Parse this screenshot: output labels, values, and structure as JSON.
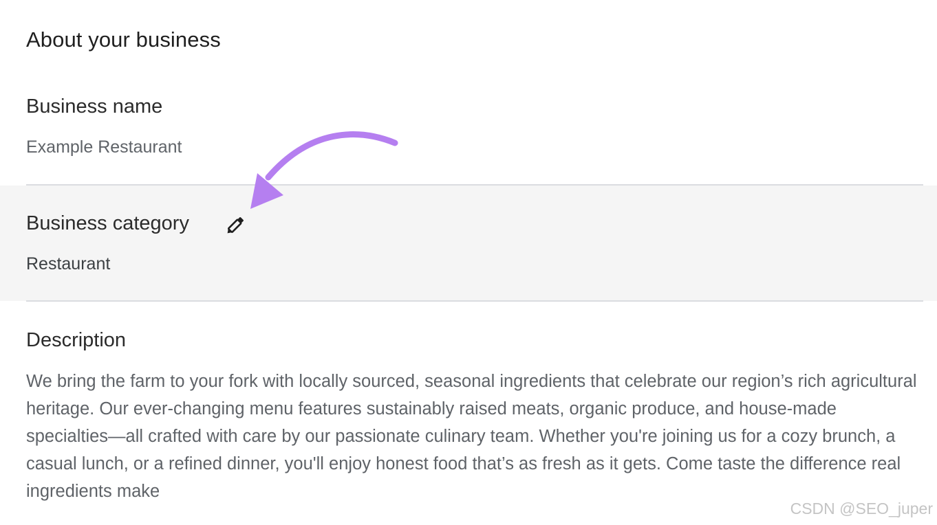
{
  "section": {
    "title": "About your business"
  },
  "business_name": {
    "label": "Business name",
    "value": "Example Restaurant"
  },
  "business_category": {
    "label": "Business category",
    "value": "Restaurant",
    "edit_icon": "pencil-icon"
  },
  "description": {
    "label": "Description",
    "text": "We bring the farm to your fork with locally sourced, seasonal ingredients that celebrate our region’s rich agricultural heritage. Our ever-changing menu features sustainably raised meats, organic produce, and house-made specialties—all crafted with care by our passionate culinary team. Whether you're joining us for a cozy brunch, a casual lunch, or a refined dinner, you'll enjoy honest food that’s as fresh as it gets. Come taste the difference real ingredients make"
  },
  "annotation": {
    "arrow_color": "#b57ff0",
    "arrow_icon": "curved-arrow-icon"
  },
  "watermark": {
    "text": "CSDN @SEO_juper"
  },
  "colors": {
    "highlight_background": "#f5f5f5",
    "divider": "#dadce0",
    "heading": "#1f1f1f",
    "secondary_text": "#5f6368"
  }
}
